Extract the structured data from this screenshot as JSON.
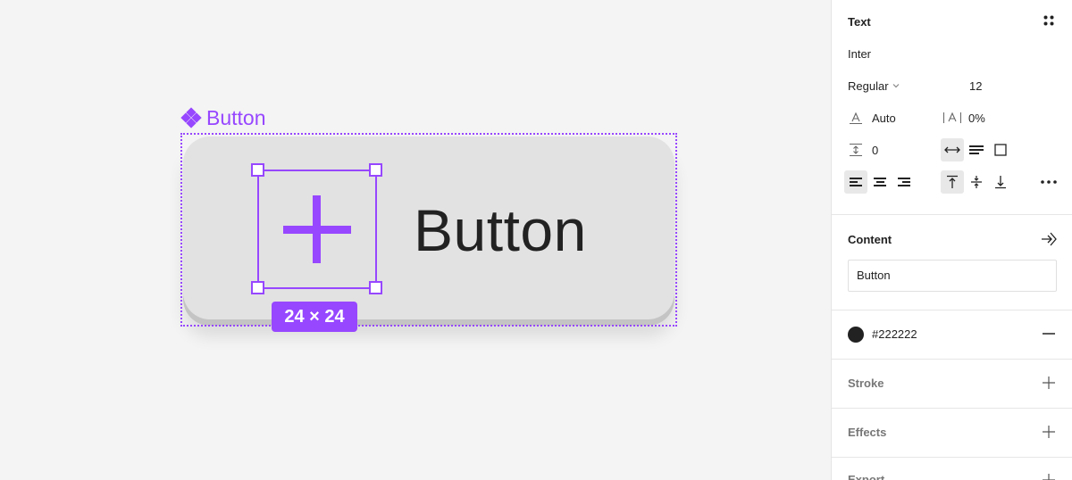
{
  "canvas": {
    "component_label": "Button",
    "button_text": "Button",
    "size_badge": "24 × 24",
    "accent_color": "#9747ff",
    "icon": "plus-icon"
  },
  "panel": {
    "text_section": {
      "title": "Text",
      "font_family": "Inter",
      "font_weight": "Regular",
      "font_size": "12",
      "line_height": "Auto",
      "letter_spacing": "0%",
      "paragraph_spacing": "0"
    },
    "content": {
      "title": "Content",
      "value": "Button"
    },
    "fill": {
      "color": "#222222"
    },
    "stroke": {
      "title": "Stroke"
    },
    "effects": {
      "title": "Effects"
    },
    "export": {
      "title": "Export"
    }
  }
}
